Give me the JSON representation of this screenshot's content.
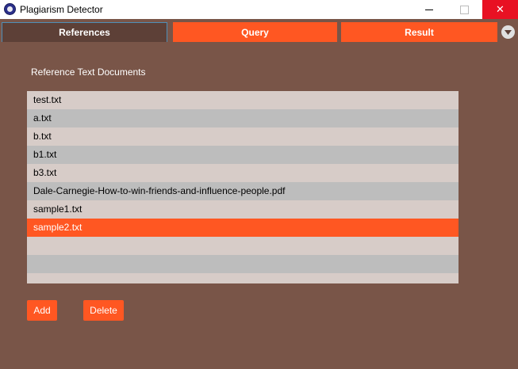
{
  "window": {
    "title": "Plagiarism Detector",
    "minimize_label": "—",
    "close_label": "✕"
  },
  "tabs": {
    "items": [
      {
        "label": "References",
        "selected": true
      },
      {
        "label": "Query",
        "selected": false
      },
      {
        "label": "Result",
        "selected": false
      }
    ],
    "dropdown_icon": "chevron-down-icon"
  },
  "references": {
    "section_label": "Reference Text Documents",
    "files": [
      "test.txt",
      "a.txt",
      "b.txt",
      "b1.txt",
      "b3.txt",
      "Dale-Carnegie-How-to-win-friends-and-influence-people.pdf",
      "sample1.txt",
      "sample2.txt"
    ],
    "selected_file": "sample2.txt"
  },
  "actions": {
    "add_label": "Add",
    "delete_label": "Delete"
  },
  "colors": {
    "background": "#795548",
    "accent": "#ff5722",
    "active_tab": "#5d4037",
    "list_row": "#d7ccc8",
    "list_row_alt": "#bdbdbd",
    "close_button": "#e81123"
  }
}
